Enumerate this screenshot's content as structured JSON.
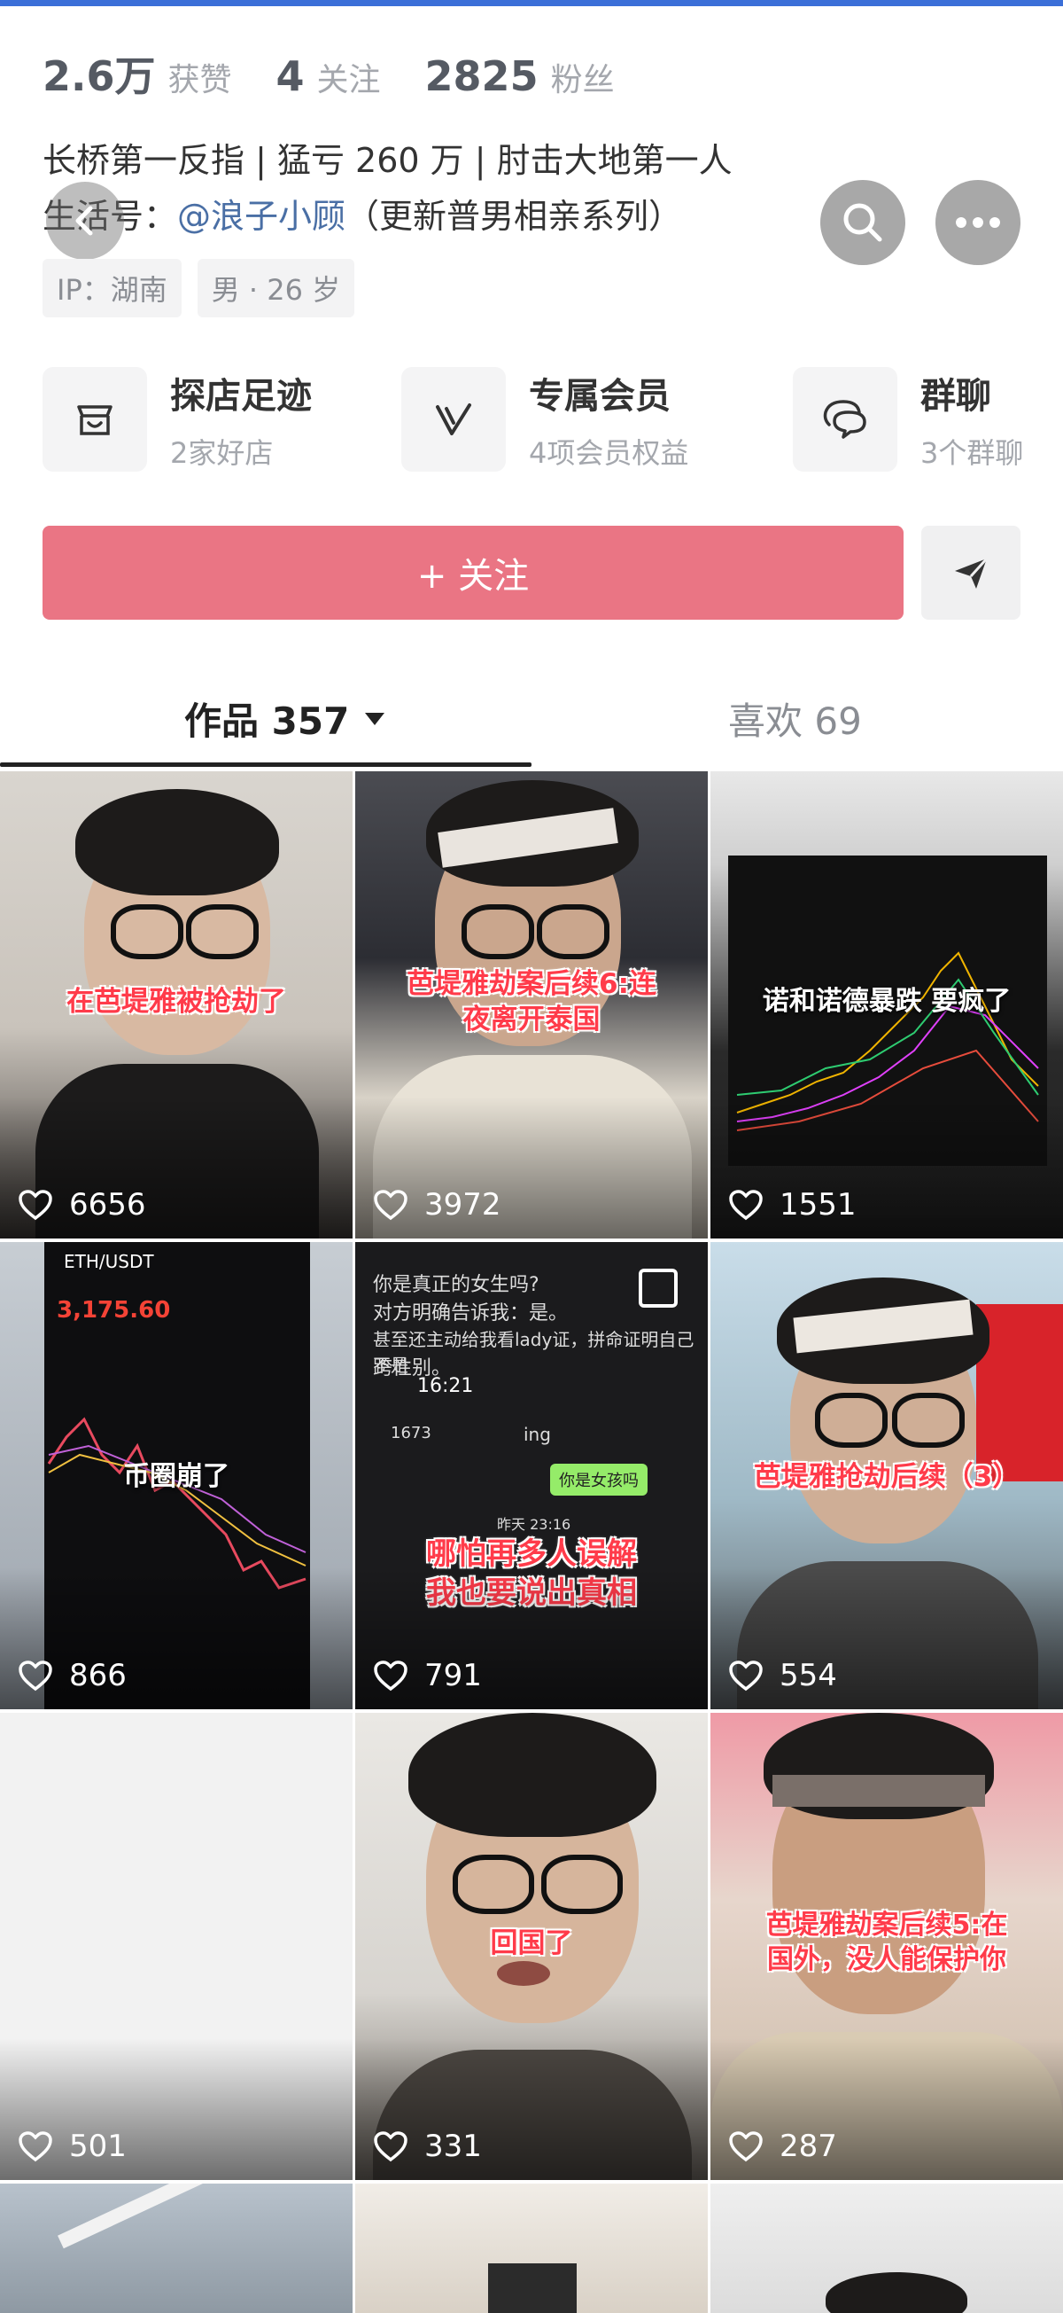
{
  "stats": [
    {
      "num": "2.6万",
      "label": "获赞"
    },
    {
      "num": "4",
      "label": "关注"
    },
    {
      "num": "2825",
      "label": "粉丝"
    }
  ],
  "bio": {
    "line1": "长桥第一反指 | 猛亏 260 万 | 肘击大地第一人",
    "line2_prefix": "生活号：",
    "line2_mention": "@浪子小顾",
    "line2_suffix": "（更新普男相亲系列）"
  },
  "tags": [
    "IP：湖南",
    "男 · 26 岁"
  ],
  "shortcuts": [
    {
      "title": "探店足迹",
      "sub": "2家好店",
      "icon": "store-icon"
    },
    {
      "title": "专属会员",
      "sub": "4项会员权益",
      "icon": "vip-icon"
    },
    {
      "title": "群聊",
      "sub": "3个群聊",
      "icon": "chat-bubble-icon"
    }
  ],
  "follow": {
    "label": "+ 关注"
  },
  "tabs": {
    "works": "作品 357",
    "likes": "喜欢 69"
  },
  "videos": [
    {
      "likes": "6656",
      "caption": "在芭堤雅被抢劫了"
    },
    {
      "likes": "3972",
      "caption": "芭堤雅劫案后续6:连\n夜离开泰国"
    },
    {
      "likes": "1551",
      "caption": "诺和诺德暴跌 要疯了"
    },
    {
      "likes": "866",
      "caption": "币圈崩了",
      "chart_title": "ETH/USDT",
      "price": "3,175.60"
    },
    {
      "likes": "791",
      "caption": "哪怕再多人误解\n我也要说出真相",
      "top1": "你是真正的女生吗?",
      "top2": "对方明确告诉我：是。",
      "top3": "甚至还主动给我看lady证，拼命证明自己不是",
      "top4": "跨性别。",
      "time": "16:21",
      "chatname": "ing",
      "bubble": "你是女孩吗",
      "count": "1673",
      "date": "昨天 23:16"
    },
    {
      "likes": "554",
      "caption": "芭堤雅抢劫后续（3）"
    },
    {
      "likes": "501",
      "caption": ""
    },
    {
      "likes": "331",
      "caption": "回国了"
    },
    {
      "likes": "287",
      "caption": "芭堤雅劫案后续5:在\n国外，没人能保护你"
    }
  ],
  "colors": {
    "follow": "#ea7584",
    "mention": "#4a6fa5",
    "caption": "#ff3b4a"
  }
}
